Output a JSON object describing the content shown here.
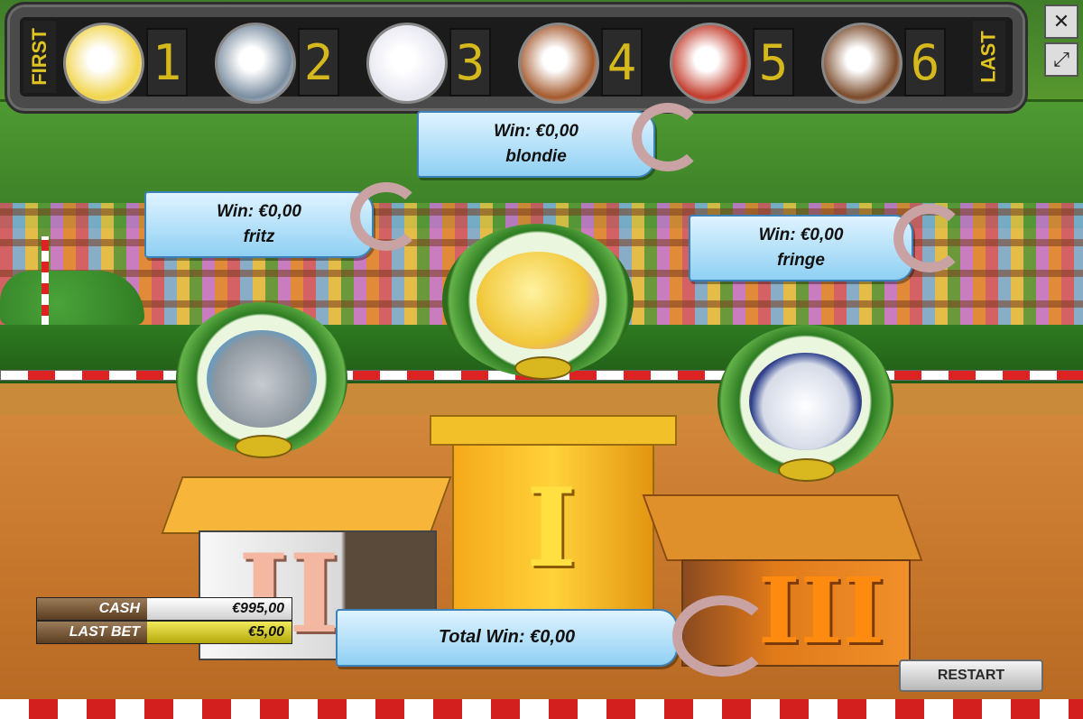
{
  "topbar": {
    "first_label": "FIRST",
    "last_label": "LAST",
    "slots": [
      {
        "place": "1",
        "horse": "blondie",
        "color": "#f1d44b"
      },
      {
        "place": "2",
        "horse": "fritz",
        "color": "#7a8da0"
      },
      {
        "place": "3",
        "horse": "fringe",
        "color": "#e6e6f0"
      },
      {
        "place": "4",
        "horse": "horse-4",
        "color": "#a45a2e"
      },
      {
        "place": "5",
        "horse": "horse-5",
        "color": "#c23a2a"
      },
      {
        "place": "6",
        "horse": "horse-6",
        "color": "#7a4a2a"
      }
    ]
  },
  "window_controls": {
    "close_icon": "close-icon",
    "resize_icon": "resize-icon"
  },
  "banners": {
    "first": {
      "win": "Win:  €0,00",
      "name": "blondie"
    },
    "second": {
      "win": "Win:  €0,00",
      "name": "fritz"
    },
    "third": {
      "win": "Win:  €0,00",
      "name": "fringe"
    },
    "total": "Total Win:  €0,00"
  },
  "podium": {
    "first": "I",
    "second": "II",
    "third": "III"
  },
  "hud": {
    "cash_label": "CASH",
    "cash_value": "€995,00",
    "lastbet_label": "LAST BET",
    "lastbet_value": "€5,00"
  },
  "restart_label": "RESTART",
  "colors": {
    "banner": "#9fd6f5",
    "gold": "#f0c020",
    "track": "#c97a2e"
  }
}
